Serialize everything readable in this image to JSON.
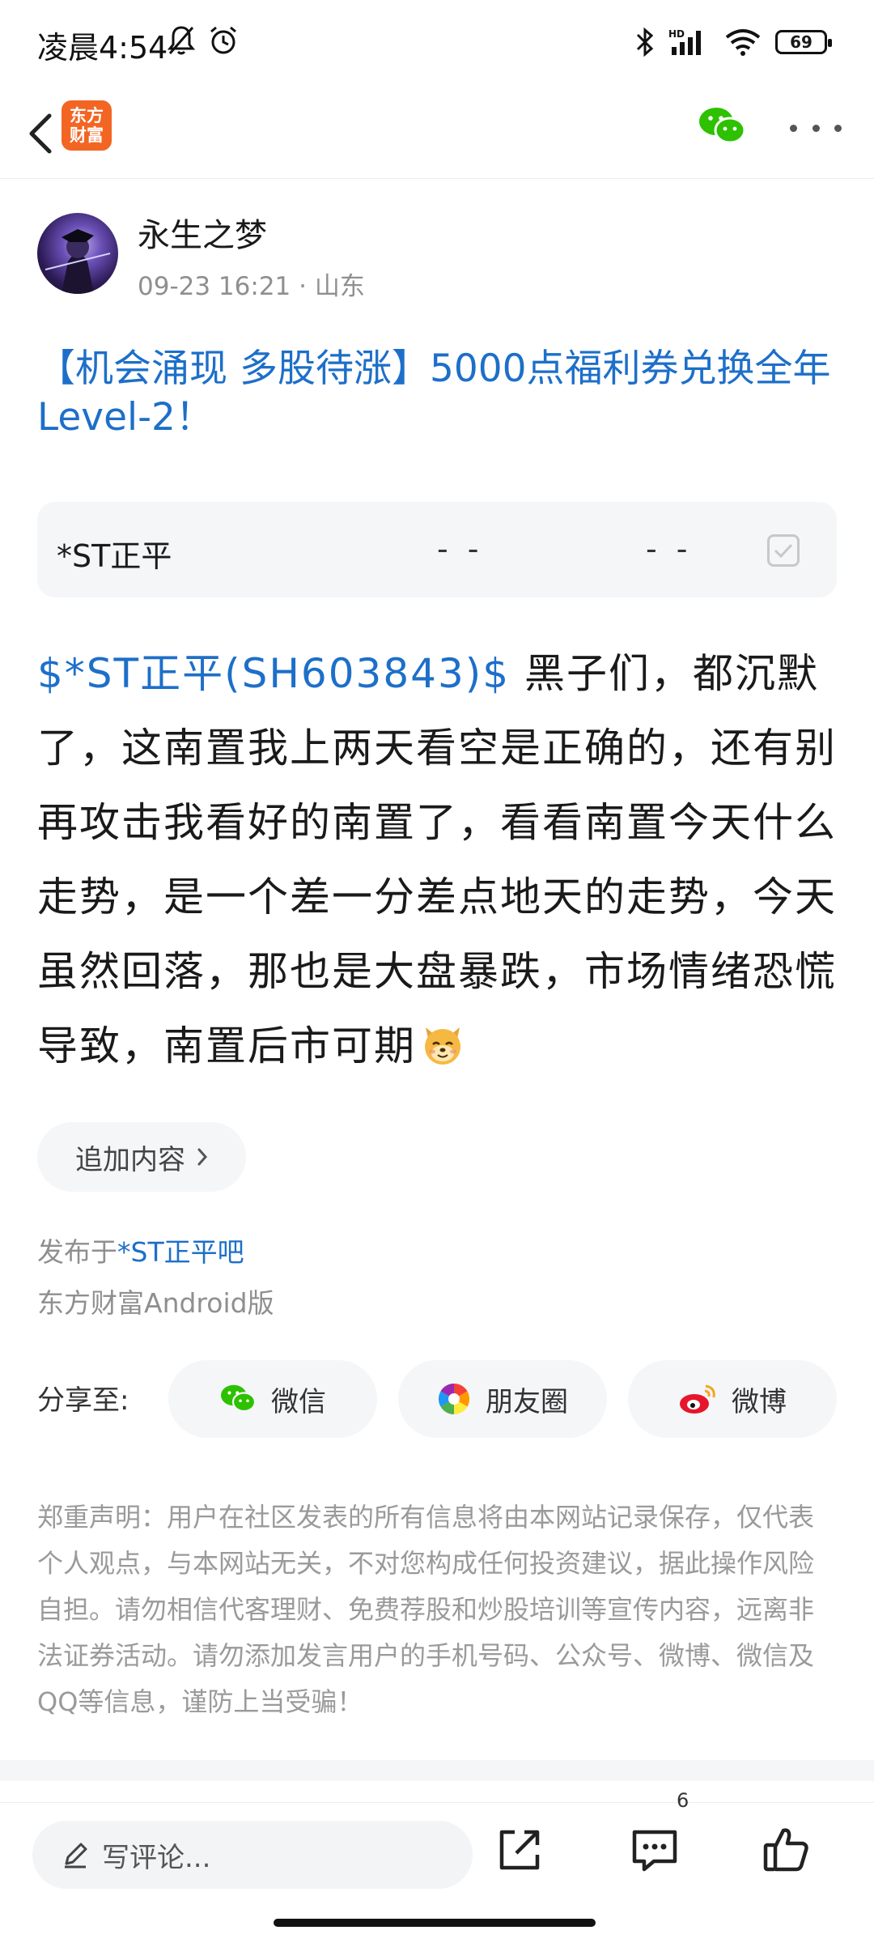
{
  "status_bar": {
    "time": "凌晨4:54",
    "network": "HD",
    "battery": "69"
  },
  "nav": {
    "logo_line1": "东方",
    "logo_line2": "财富"
  },
  "author": {
    "name": "永生之梦",
    "meta": "09-23 16:21 · 山东"
  },
  "post": {
    "title": "【机会涌现 多股待涨】5000点福利券兑换全年Level-2！",
    "stock_tag": "$*ST正平(SH603843)$",
    "body": "  黑子们，都沉默了，这南置我上两天看空是正确的，还有别再攻击我看好的南置了，看看南置今天什么走势，是一个差一分差点地天的走势，今天虽然回落，那也是大盘暴跌，市场情绪恐慌导致，南置后市可期"
  },
  "stock_card": {
    "name": "*ST正平",
    "price": "- -",
    "change": "- -"
  },
  "append_button_label": "追加内容",
  "published": {
    "prefix": "发布于",
    "bar_name": "*ST正平吧",
    "client": "东方财富Android版"
  },
  "share": {
    "label": "分享至:",
    "options": [
      "微信",
      "朋友圈",
      "微博"
    ]
  },
  "disclaimer": "郑重声明：用户在社区发表的所有信息将由本网站记录保存，仅代表个人观点，与本网站无关，不对您构成任何投资建议，据此操作风险自担。请勿相信代客理财、免费荐股和炒股培训等宣传内容，远离非法证券活动。请勿添加发言用户的手机号码、公众号、微博、微信及QQ等信息，谨防上当受骗！",
  "bottom_bar": {
    "comment_placeholder": "写评论...",
    "comment_count": "6"
  },
  "colors": {
    "link_blue": "#1d6fc9",
    "brand_orange": "#f26522",
    "wechat_green": "#2dc100"
  }
}
